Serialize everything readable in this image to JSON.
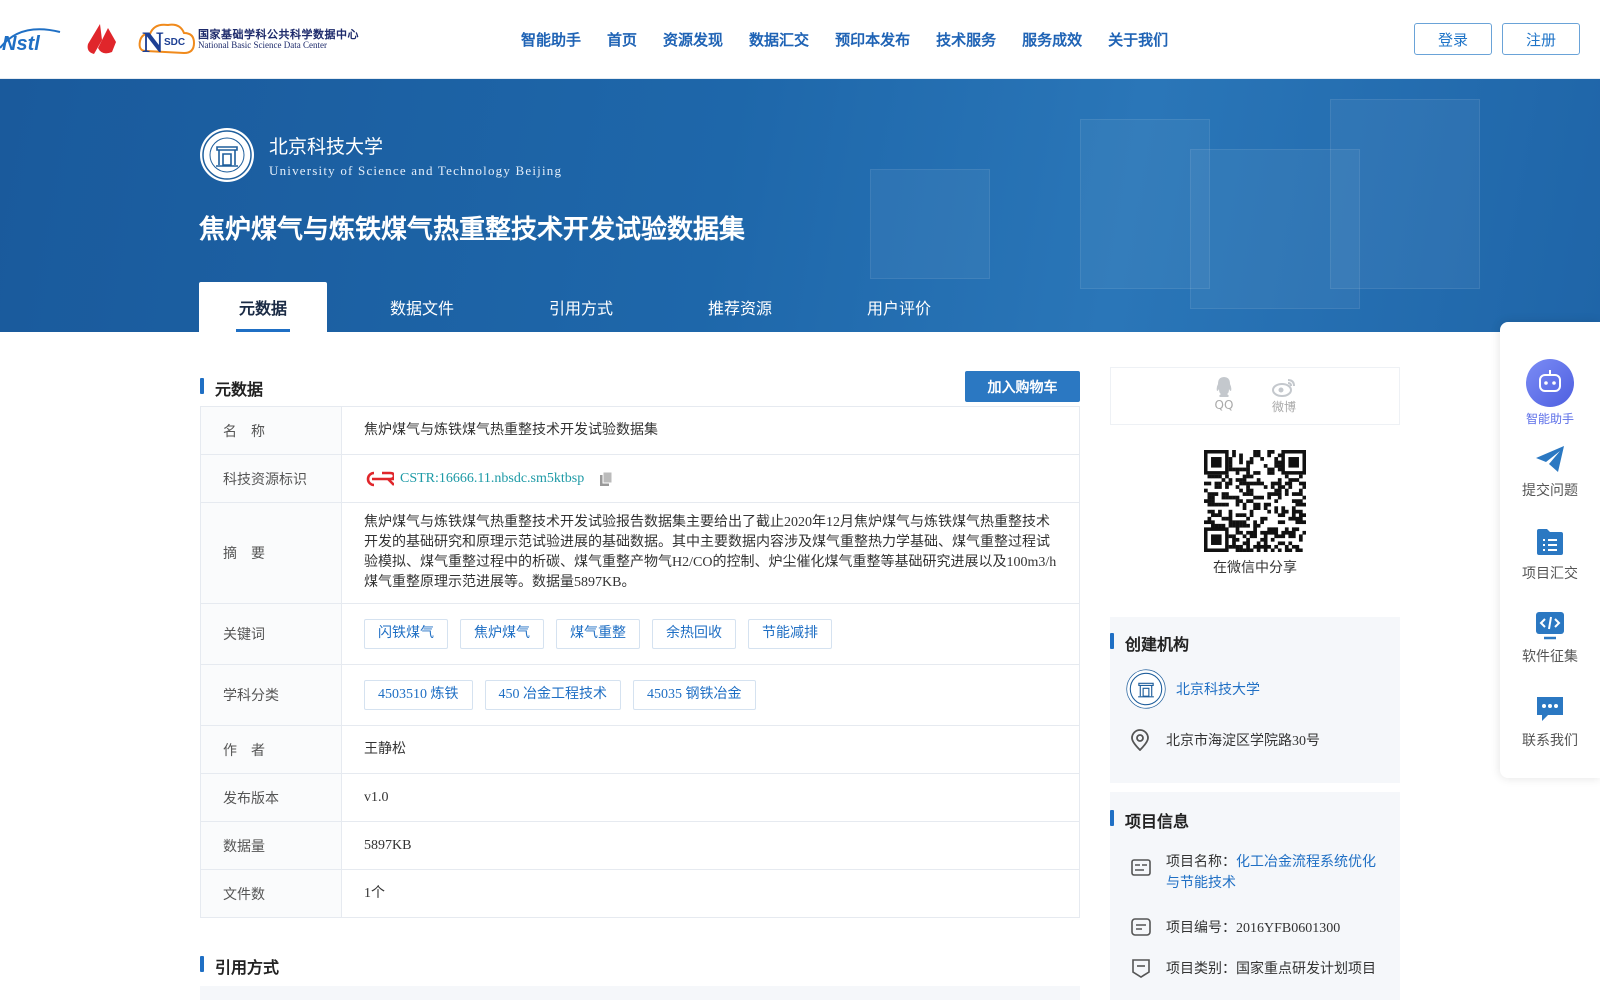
{
  "header": {
    "nsdc_cn": "国家基础学科公共科学数据中心",
    "nsdc_en": "National Basic Science Data Center",
    "nav": [
      "智能助手",
      "首页",
      "资源发现",
      "数据汇交",
      "预印本发布",
      "技术服务",
      "服务成效",
      "关于我们"
    ],
    "login": "登录",
    "register": "注册"
  },
  "banner": {
    "univ_cn": "北京科技大学",
    "univ_en": "University of Science and Technology Beijing",
    "title": "焦炉煤气与炼铁煤气热重整技术开发试验数据集",
    "tabs": [
      "元数据",
      "数据文件",
      "引用方式",
      "推荐资源",
      "用户评价"
    ]
  },
  "meta": {
    "section_title": "元数据",
    "cart_label": "加入购物车",
    "rows": {
      "name_k": "名　称",
      "name_v": "焦炉煤气与炼铁煤气热重整技术开发试验数据集",
      "id_k": "科技资源标识",
      "id_v": "CSTR:16666.11.nbsdc.sm5ktbsp",
      "abstract_k": "摘　要",
      "abstract_v": "焦炉煤气与炼铁煤气热重整技术开发试验报告数据集主要给出了截止2020年12月焦炉煤气与炼铁煤气热重整技术开发的基础研究和原理示范试验进展的基础数据。其中主要数据内容涉及煤气重整热力学基础、煤气重整过程试验模拟、煤气重整过程中的析碳、煤气重整产物气H2/CO的控制、炉尘催化煤气重整等基础研究进展以及100m3/h煤气重整原理示范进展等。数据量5897KB。",
      "keywords_k": "关键词",
      "keywords": [
        "闪铁煤气",
        "焦炉煤气",
        "煤气重整",
        "余热回收",
        "节能减排"
      ],
      "subject_k": "学科分类",
      "subjects": [
        "4503510 炼铁",
        "450 冶金工程技术",
        "45035 钢铁冶金"
      ],
      "author_k": "作　者",
      "author_v": "王静松",
      "version_k": "发布版本",
      "version_v": "v1.0",
      "size_k": "数据量",
      "size_v": "5897KB",
      "files_k": "文件数",
      "files_v": "1个"
    }
  },
  "citation": {
    "section_title": "引用方式"
  },
  "share": {
    "qq": "QQ",
    "weibo": "微博",
    "wechat": "在微信中分享"
  },
  "org": {
    "section_title": "创建机构",
    "name": "北京科技大学",
    "address": "北京市海淀区学院路30号"
  },
  "project": {
    "section_title": "项目信息",
    "name_label": "项目名称：",
    "name_value": "化工冶金流程系统优化与节能技术",
    "code": "项目编号：2016YFB0601300",
    "category": "项目类别：国家重点研发计划项目"
  },
  "float": {
    "assistant": "智能助手",
    "submit": "提交问题",
    "project": "项目汇交",
    "software": "软件征集",
    "contact": "联系我们"
  },
  "colors": {
    "primary": "#1f6fc4",
    "banner": "#1e67aa",
    "assistant": "#5b6ee8"
  }
}
